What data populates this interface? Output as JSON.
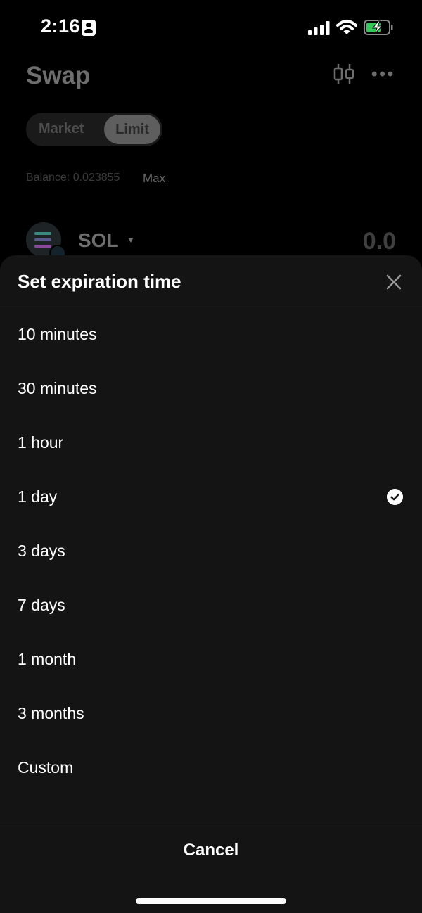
{
  "status_bar": {
    "time": "2:16",
    "battery_color": "#34c759"
  },
  "background": {
    "title": "Swap",
    "segments": {
      "market": "Market",
      "limit": "Limit",
      "selected": "Limit"
    },
    "balance_label": "Balance: 0.023855",
    "max_label": "Max",
    "token": {
      "symbol": "SOL",
      "amount": "0.0"
    }
  },
  "sheet": {
    "title": "Set expiration time",
    "options": [
      {
        "label": "10 minutes",
        "selected": false
      },
      {
        "label": "30 minutes",
        "selected": false
      },
      {
        "label": "1 hour",
        "selected": false
      },
      {
        "label": "1 day",
        "selected": true
      },
      {
        "label": "3 days",
        "selected": false
      },
      {
        "label": "7 days",
        "selected": false
      },
      {
        "label": "1 month",
        "selected": false
      },
      {
        "label": "3 months",
        "selected": false
      },
      {
        "label": "Custom",
        "selected": false
      }
    ],
    "cancel_label": "Cancel"
  }
}
